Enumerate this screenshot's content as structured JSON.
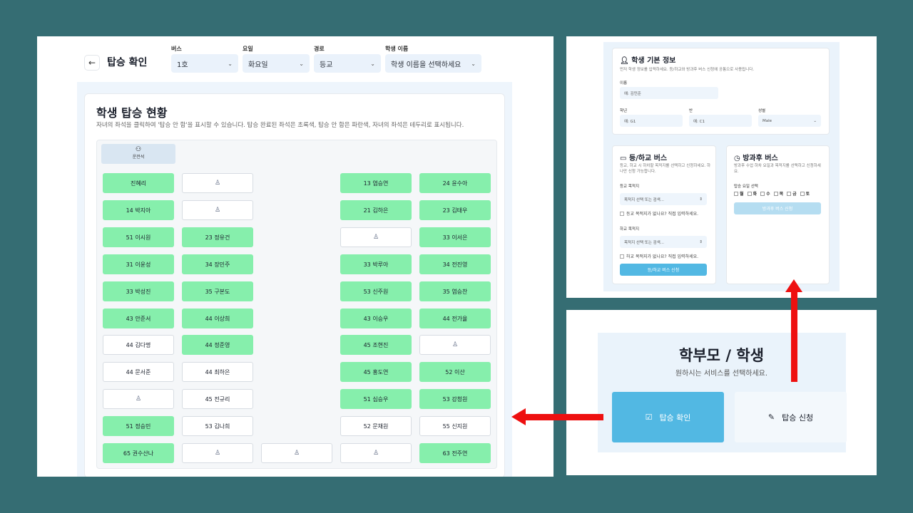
{
  "check_screen": {
    "title": "탑승 확인",
    "filters": [
      {
        "label": "버스",
        "value": "1호"
      },
      {
        "label": "요일",
        "value": "화요일"
      },
      {
        "label": "경로",
        "value": "등교"
      },
      {
        "label": "학생 이름",
        "value": "학생 이름을 선택하세요"
      }
    ],
    "board_title": "학생 탑승 현황",
    "board_desc": "자녀의 좌석을 클릭하여 '탑승 안 함'을 표시할 수 있습니다. 탑승 완료된 좌석은 초록색, 탑승 안 함은 파란색, 자녀의 좌석은 테두리로 표시됩니다.",
    "driver_label": "운전석",
    "seats": [
      {
        "text": "진혜리",
        "state": "green"
      },
      {
        "text": "",
        "state": "empty"
      },
      null,
      {
        "text": "13 염승연",
        "state": "green"
      },
      {
        "text": "24 윤수아",
        "state": "green"
      },
      {
        "text": "14 박지아",
        "state": "green"
      },
      {
        "text": "",
        "state": "empty"
      },
      null,
      {
        "text": "21 김하은",
        "state": "green"
      },
      {
        "text": "23 김태우",
        "state": "green"
      },
      {
        "text": "51 이시원",
        "state": "green"
      },
      {
        "text": "23 정유건",
        "state": "green"
      },
      null,
      {
        "text": "",
        "state": "empty"
      },
      {
        "text": "33 이서은",
        "state": "green"
      },
      {
        "text": "31 이윤성",
        "state": "green"
      },
      {
        "text": "34 장민주",
        "state": "green"
      },
      null,
      {
        "text": "33 박루아",
        "state": "green"
      },
      {
        "text": "34 전진영",
        "state": "green"
      },
      {
        "text": "33 박성진",
        "state": "green"
      },
      {
        "text": "35 구본도",
        "state": "green"
      },
      null,
      {
        "text": "53 신주원",
        "state": "green"
      },
      {
        "text": "35 염승찬",
        "state": "green"
      },
      {
        "text": "43 안준서",
        "state": "green"
      },
      {
        "text": "44 이상희",
        "state": "green"
      },
      null,
      {
        "text": "43 이승우",
        "state": "green"
      },
      {
        "text": "44 전가율",
        "state": "green"
      },
      {
        "text": "44 김다명",
        "state": "white"
      },
      {
        "text": "44 정준영",
        "state": "green"
      },
      null,
      {
        "text": "45 조현진",
        "state": "green"
      },
      {
        "text": "",
        "state": "empty"
      },
      {
        "text": "44 문서준",
        "state": "white"
      },
      {
        "text": "44 최하은",
        "state": "white"
      },
      null,
      {
        "text": "45 홍도연",
        "state": "green"
      },
      {
        "text": "52 이산",
        "state": "green"
      },
      {
        "text": "",
        "state": "empty"
      },
      {
        "text": "45 전규리",
        "state": "white"
      },
      null,
      {
        "text": "51 심승우",
        "state": "green"
      },
      {
        "text": "53 강청원",
        "state": "green"
      },
      {
        "text": "51 정승민",
        "state": "green"
      },
      {
        "text": "53 김나희",
        "state": "white"
      },
      null,
      {
        "text": "52 문채원",
        "state": "white"
      },
      {
        "text": "55 신지원",
        "state": "white"
      },
      {
        "text": "65 권수산나",
        "state": "green"
      },
      {
        "text": "",
        "state": "empty"
      },
      {
        "text": "",
        "state": "empty"
      },
      {
        "text": "",
        "state": "empty"
      },
      {
        "text": "63 전주연",
        "state": "green"
      }
    ]
  },
  "apply_screen": {
    "info_title": "학생 기본 정보",
    "info_desc": "먼저 학생 정보를 입력하세요. 등/하교와 방과후 버스 신청에 공통으로 사용됩니다.",
    "name_label": "이름",
    "name_placeholder": "예: 김민준",
    "grade_label": "학년",
    "grade_placeholder": "예: G1",
    "class_label": "반",
    "class_placeholder": "예: C1",
    "gender_label": "성별",
    "gender_value": "Male",
    "commute_title": "등/하교 버스",
    "commute_desc": "등교, 하교 시 하차할 목적지를 선택하고 신청하세요. 하나만 신청 가능합니다.",
    "go_label": "등교 목적지",
    "go_placeholder": "목적지 선택 또는 검색...",
    "go_check": "등교 목적지가 없나요? 직접 입력하세요.",
    "back_label": "하교 목적지",
    "back_placeholder": "목적지 선택 또는 검색...",
    "back_check": "하교 목적지가 없나요? 직접 입력하세요.",
    "commute_button": "등/하교 버스 신청",
    "after_title": "방과후 버스",
    "after_desc": "방과후 수업 하차 요일과 목적지를 선택하고 신청하세요.",
    "days_label": "탑승 요일 선택",
    "days": [
      "월",
      "화",
      "수",
      "목",
      "금",
      "토"
    ],
    "after_button": "방과후 버스 신청"
  },
  "home_screen": {
    "title": "학부모 / 학생",
    "subtitle": "원하시는 서비스를 선택하세요.",
    "check_button": "탑승 확인",
    "apply_button": "탑승 신청"
  },
  "icons": {
    "back": "arrow-left-icon",
    "chevron": "chevron-down-icon",
    "person": "person-icon",
    "steering": "steering-wheel-icon",
    "user_plus": "user-plus-icon",
    "bus": "bus-icon",
    "clock": "clock-icon",
    "check_square": "check-square-icon",
    "edit": "edit-icon"
  },
  "colors": {
    "background": "#356d73",
    "seat_boarded": "#86efac",
    "primary_button": "#52b8e3",
    "arrow": "#ee1010"
  }
}
